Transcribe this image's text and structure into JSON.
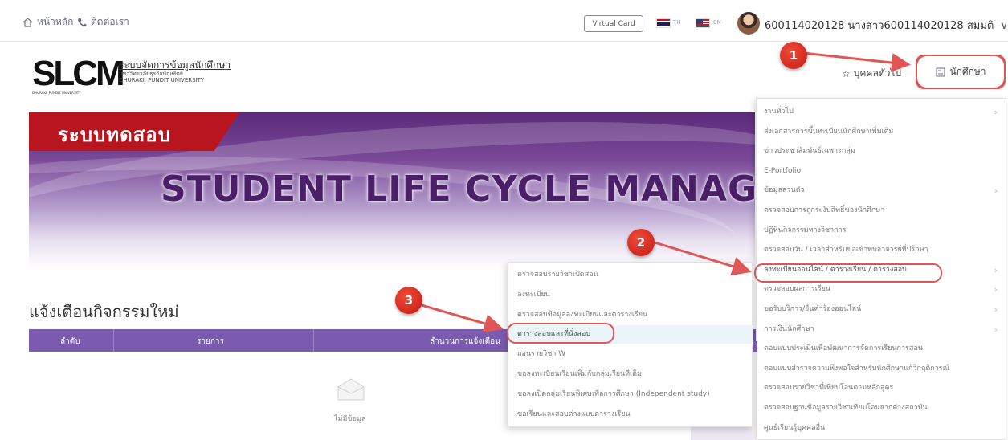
{
  "topbar": {
    "home_label": "หน้าหลัก",
    "contact_label": "ติดต่อเรา",
    "virtual_card_label": "Virtual Card",
    "lang_th": "TH",
    "lang_en": "EN",
    "user_label": "600114020128 นางสาว600114020128 สมมติ"
  },
  "header": {
    "logo_text": "SLCM",
    "logo_sub": "DHURAKIJ PUNDIT UNIVERSITY",
    "system_name": "ระบบจัดการข้อมูลนักศึกษา",
    "university_th": "มหาวิทยาลัยธุรกิจบัณฑิตย์",
    "university_en": "DHURAKIJ PUNDIT UNIVERSITY",
    "personnel_label": "บุคคลทั่วไป",
    "student_label": "นักศึกษา"
  },
  "banner": {
    "tag": "ระบบทดสอบ",
    "title": "STUDENT LIFE CYCLE MANAGE"
  },
  "activity": {
    "title": "แจ้งเตือนกิจกรรมใหม่",
    "columns": [
      "ลำดับ",
      "รายการ",
      "ลำนวนการแจ้งเตือน"
    ],
    "empty_text": "ไม่มีข้อมูล"
  },
  "student_menu": {
    "items": [
      {
        "label": "งานทั่วไป",
        "has_sub": true
      },
      {
        "label": "ส่งเอกสารการขึ้นทะเบียนนักศึกษาเพิ่มเติม",
        "has_sub": false
      },
      {
        "label": "ข่าวประชาสัมพันธ์เฉพาะกลุ่ม",
        "has_sub": false
      },
      {
        "label": "E-Portfolio",
        "has_sub": false
      },
      {
        "label": "ข้อมูลส่วนตัว",
        "has_sub": true
      },
      {
        "label": "ตรวจสอบการถูกระงับสิทธิ์ของนักศึกษา",
        "has_sub": false
      },
      {
        "label": "ปฏิทินกิจกรรมทางวิชาการ",
        "has_sub": false
      },
      {
        "label": "ตรวจสอบวัน / เวลาสำหรับขอเข้าพบอาจารย์ที่ปรึกษา",
        "has_sub": false
      },
      {
        "label": "ลงทะเบียนออนไลน์ / ตารางเรียน / ตารางสอบ",
        "has_sub": true
      },
      {
        "label": "ตรวจสอบผลการเรียน",
        "has_sub": true
      },
      {
        "label": "ขอรับบริการ/ยื่นคำร้องออนไลน์",
        "has_sub": true
      },
      {
        "label": "การเงินนักศึกษา",
        "has_sub": true
      },
      {
        "label": "ตอบแบบประเมินเพื่อพัฒนาการจัดการเรียนการสอน",
        "has_sub": false
      },
      {
        "label": "ตอบแบบสำรวจความพึงพอใจสำหรับนักศึกษาแก้วิกฤติการณ์",
        "has_sub": false
      },
      {
        "label": "ตรวจสอบรายวิชาที่เทียบโอนตามหลักสูตร",
        "has_sub": false
      },
      {
        "label": "ตรวจสอบฐานข้อมูลรายวิชาเทียบโอนจากต่างสถาบัน",
        "has_sub": false
      },
      {
        "label": "ศูนย์เรียนรู้บุคคลอื่น",
        "has_sub": false
      }
    ]
  },
  "sub_menu": {
    "items": [
      "ตรวจสอบรายวิชาเปิดสอน",
      "ลงทะเบียน",
      "ตรวจสอบข้อมูลลงทะเบียนและตารางเรียน",
      "ตารางสอบและที่นั่งสอบ",
      "ถอนรายวิชา W",
      "ขอลงทะเบียนเรียนเพิ่มกับกลุ่มเรียนที่เต็ม",
      "ขอลงเปิดกลุ่มเรียนพิเศษเพื่อการศึกษา (Independent study)",
      "ขอเรียนและสอบต่างแบบตารางเรียน"
    ]
  },
  "annotations": {
    "badge_1": "1",
    "badge_2": "2",
    "badge_3": "3",
    "color": "#e05656"
  }
}
